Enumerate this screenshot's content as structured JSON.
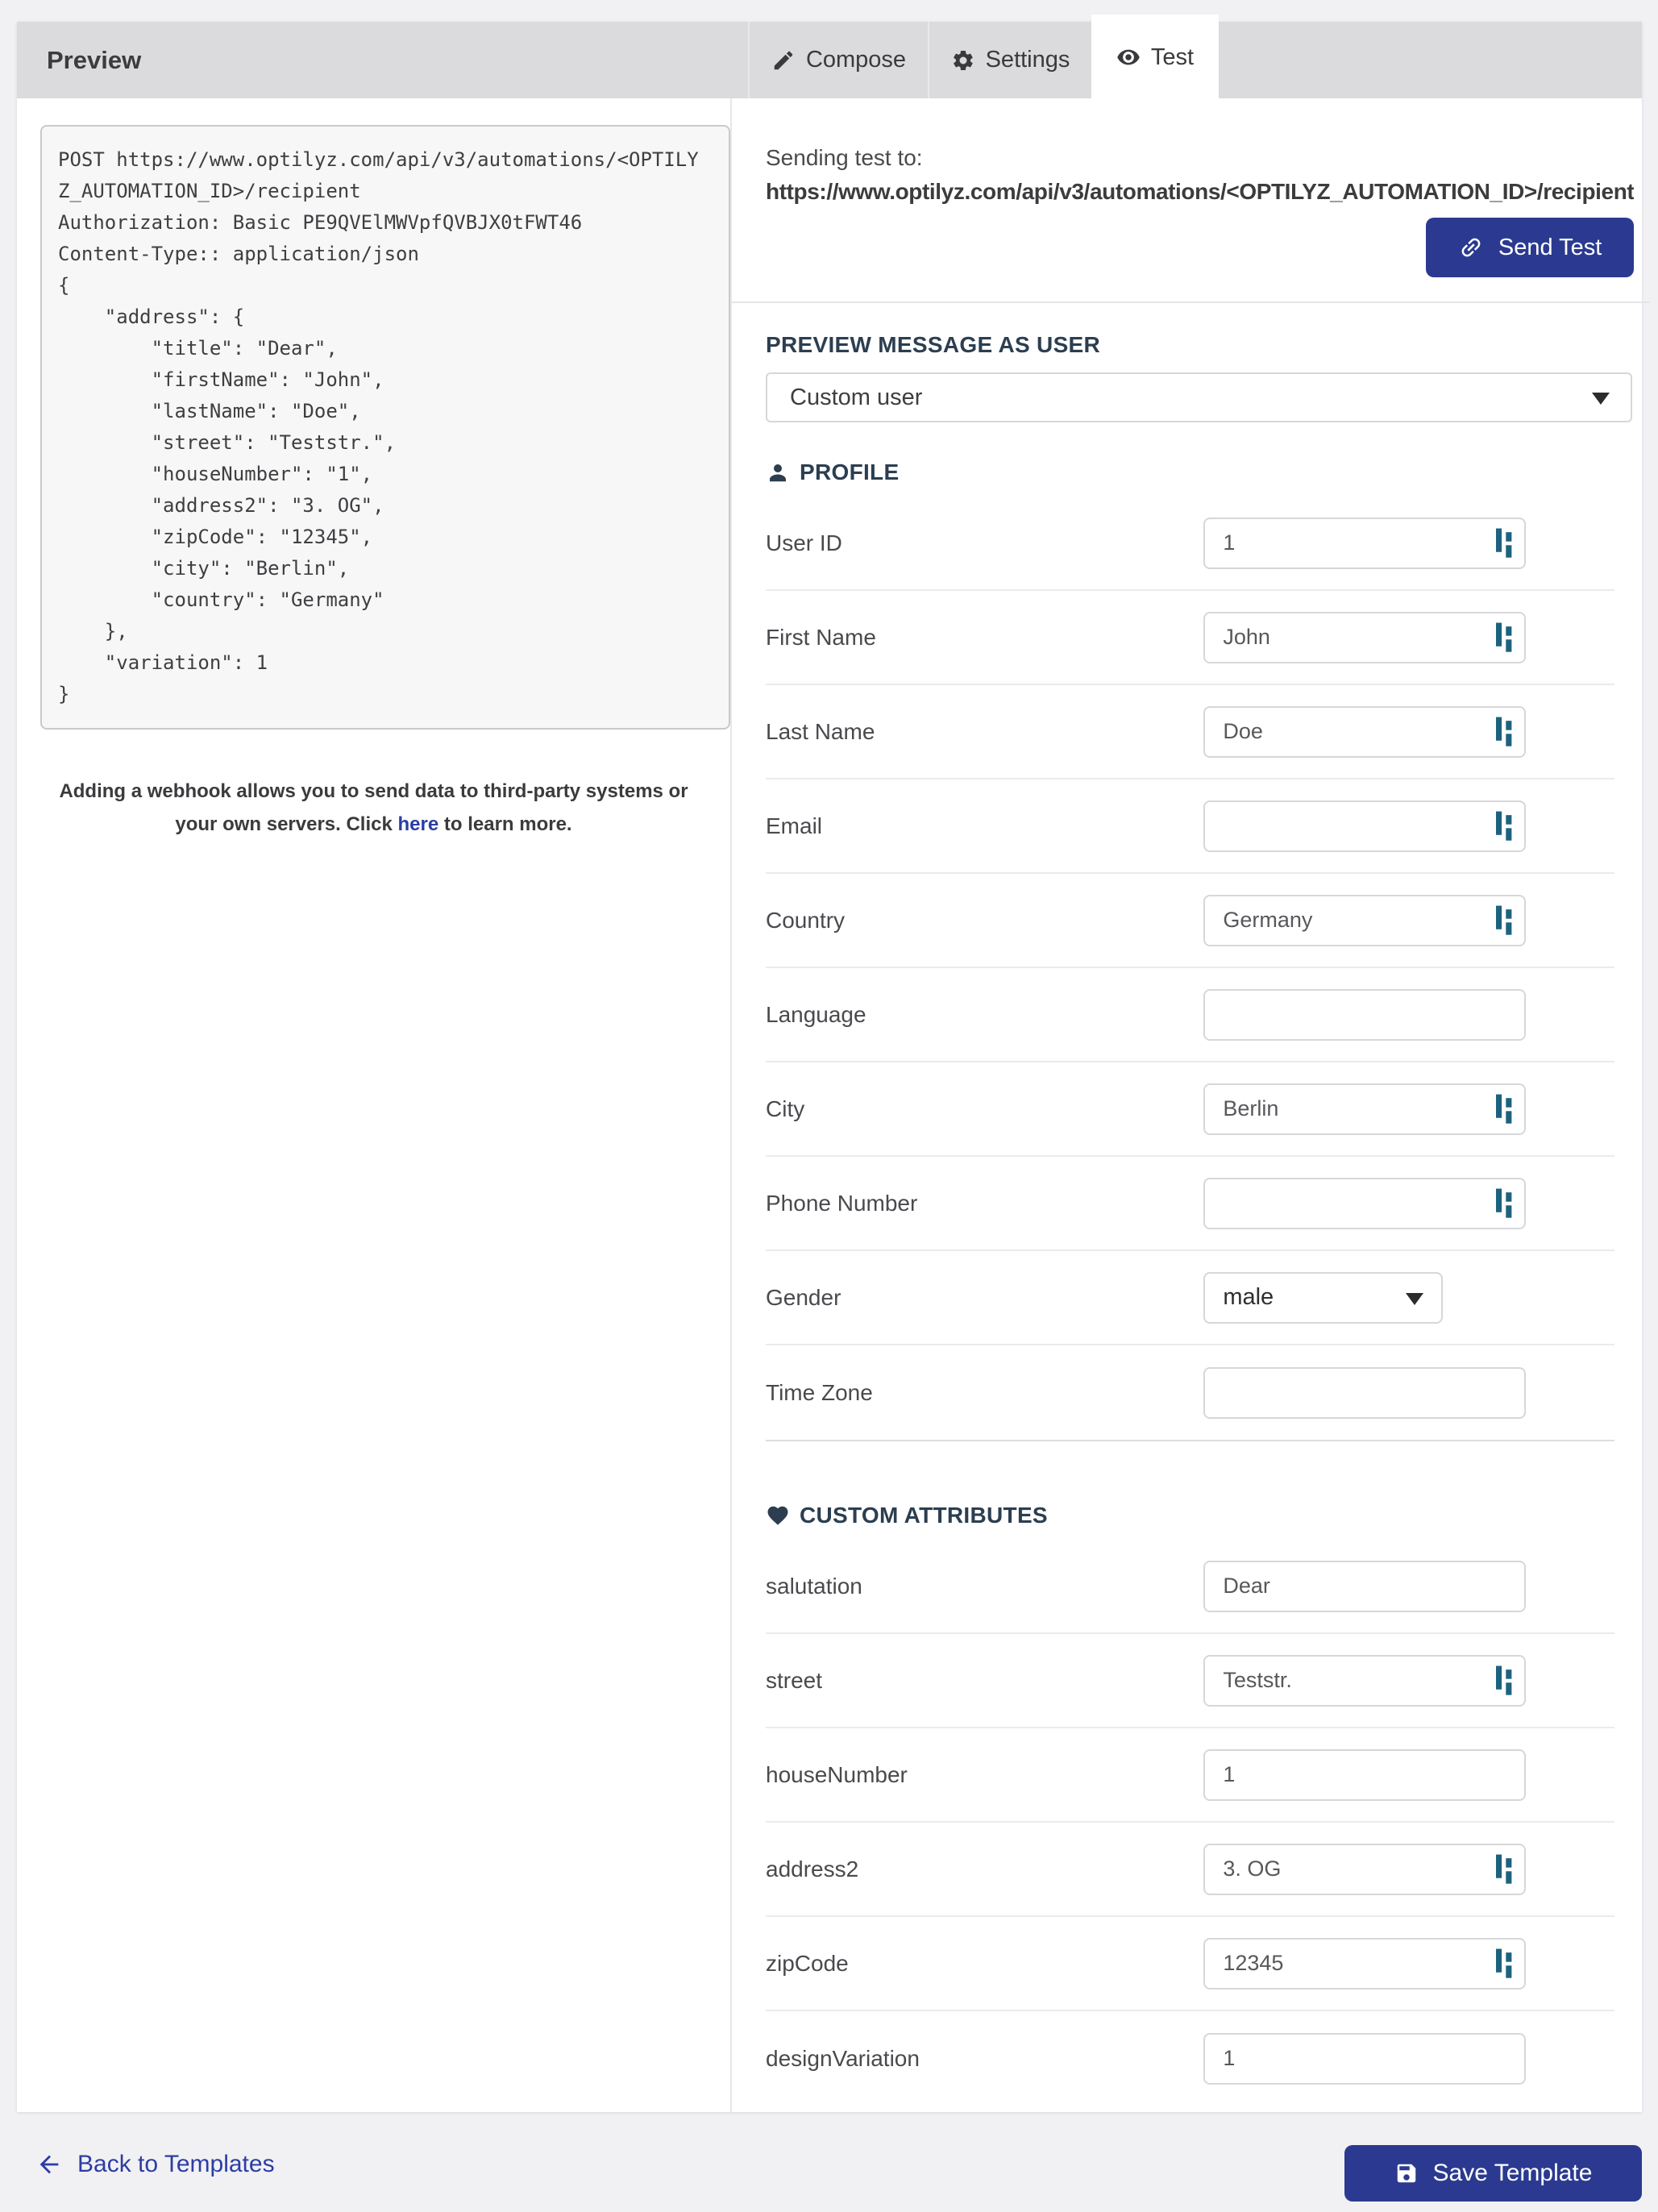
{
  "header": {
    "title": "Preview",
    "tabs": [
      {
        "label": "Compose",
        "icon": "pencil-icon",
        "active": false
      },
      {
        "label": "Settings",
        "icon": "gear-icon",
        "active": false
      },
      {
        "label": "Test",
        "icon": "eye-icon",
        "active": true
      }
    ]
  },
  "left_panel": {
    "code_lines": [
      "POST https://www.optilyz.com/api/v3/automations/<OPTILY",
      "Z_AUTOMATION_ID>/recipient",
      "Authorization: Basic PE9QVElMWVpfQVBJX0tFWT46",
      "Content-Type:: application/json",
      "{",
      "    \"address\": {",
      "        \"title\": \"Dear\",",
      "        \"firstName\": \"John\",",
      "        \"lastName\": \"Doe\",",
      "        \"street\": \"Teststr.\",",
      "        \"houseNumber\": \"1\",",
      "        \"address2\": \"3. OG\",",
      "        \"zipCode\": \"12345\",",
      "        \"city\": \"Berlin\",",
      "        \"country\": \"Germany\"",
      "    },",
      "    \"variation\": 1",
      "}"
    ],
    "webhook_note": {
      "before": "Adding a webhook allows you to send data to third-party systems or your own servers. Click ",
      "link": "here",
      "after": " to learn more."
    }
  },
  "test_panel": {
    "sending_label": "Sending test to:",
    "sending_url": "https://www.optilyz.com/api/v3/automations/<OPTILYZ_AUTOMATION_ID>/recipient",
    "send_button_label": "Send Test",
    "preview_as_heading": "PREVIEW MESSAGE AS USER",
    "user_select_value": "Custom user",
    "profile": {
      "heading": "PROFILE",
      "fields": [
        {
          "label": "User ID",
          "value": "1",
          "icon": true,
          "type": "input"
        },
        {
          "label": "First Name",
          "value": "John",
          "icon": true,
          "type": "input"
        },
        {
          "label": "Last Name",
          "value": "Doe",
          "icon": true,
          "type": "input"
        },
        {
          "label": "Email",
          "value": "",
          "icon": true,
          "type": "input"
        },
        {
          "label": "Country",
          "value": "Germany",
          "icon": true,
          "type": "input"
        },
        {
          "label": "Language",
          "value": "",
          "icon": false,
          "type": "input"
        },
        {
          "label": "City",
          "value": "Berlin",
          "icon": true,
          "type": "input"
        },
        {
          "label": "Phone Number",
          "value": "",
          "icon": true,
          "type": "input"
        },
        {
          "label": "Gender",
          "value": "male",
          "icon": false,
          "type": "select"
        },
        {
          "label": "Time Zone",
          "value": "",
          "icon": false,
          "type": "input"
        }
      ]
    },
    "custom": {
      "heading": "CUSTOM ATTRIBUTES",
      "fields": [
        {
          "label": "salutation",
          "value": "Dear",
          "icon": false,
          "type": "input"
        },
        {
          "label": "street",
          "value": "Teststr.",
          "icon": true,
          "type": "input"
        },
        {
          "label": "houseNumber",
          "value": "1",
          "icon": false,
          "type": "input"
        },
        {
          "label": "address2",
          "value": "3. OG",
          "icon": true,
          "type": "input"
        },
        {
          "label": "zipCode",
          "value": "12345",
          "icon": true,
          "type": "input"
        },
        {
          "label": "designVariation",
          "value": "1",
          "icon": false,
          "type": "input"
        }
      ]
    }
  },
  "footer": {
    "back_label": "Back to Templates",
    "save_label": "Save Template"
  },
  "colors": {
    "primary_button": "#2b3a90",
    "link": "#2c3da3",
    "section_heading": "#2c3e50",
    "brand_icon_teal": "#1d627f",
    "header_bar": "#dbdbde",
    "page_background": "#f1f1f4"
  }
}
